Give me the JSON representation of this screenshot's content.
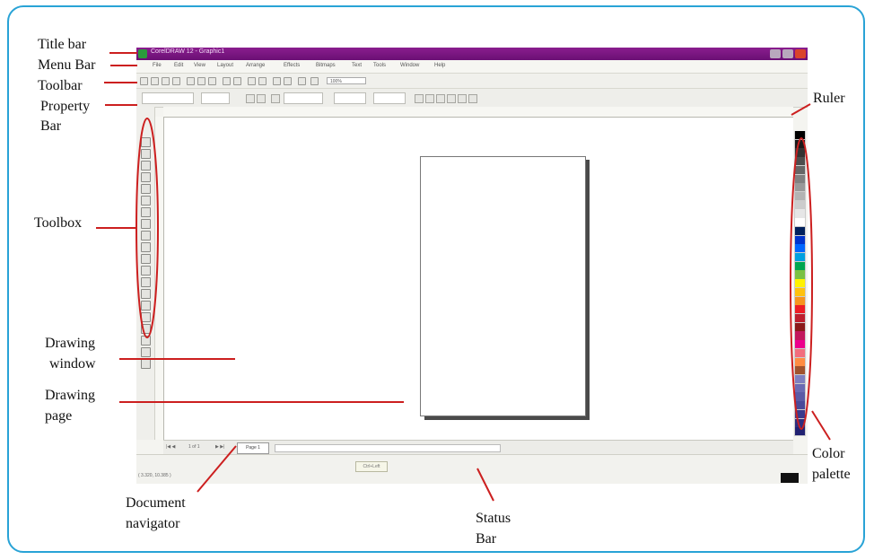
{
  "screenshot": {
    "window_title": "CorelDRAW 12 - Graphic1",
    "menu_items": [
      "File",
      "Edit",
      "View",
      "Layout",
      "Arrange",
      "Effects",
      "Bitmaps",
      "Text",
      "Tools",
      "Window",
      "Help"
    ],
    "zoom_value": "100%",
    "document_navigator": {
      "page_count_text": "1 of 1",
      "page_tab_label": "Page 1"
    },
    "status_hint": "Ctrl+Left",
    "status_coordinates": "( 3.320, 10.385 )"
  },
  "callouts": {
    "title_bar": "Title bar",
    "menu_bar": "Menu Bar",
    "toolbar": "Toolbar",
    "property_bar_line1": "Property",
    "property_bar_line2": "Bar",
    "toolbox": "Toolbox",
    "drawing_window_line1": "Drawing",
    "drawing_window_line2": "window",
    "drawing_page_line1": "Drawing",
    "drawing_page_line2": "page",
    "document_navigator_line1": "Document",
    "document_navigator_line2": "navigator",
    "ruler": "Ruler",
    "color_palette_line1": "Color",
    "color_palette_line2": "palette",
    "status_bar_line1": "Status",
    "status_bar_line2": "Bar"
  },
  "colors": {
    "frame": "#29a3d6",
    "callout_line": "#cc1f1f",
    "title_bar": "#7a1682",
    "palette_swatches": [
      "#000000",
      "#1a1a1a",
      "#333333",
      "#4d4d4d",
      "#666666",
      "#808080",
      "#999999",
      "#b3b3b3",
      "#cccccc",
      "#e6e6e6",
      "#ffffff",
      "#00205c",
      "#0033cc",
      "#0066ff",
      "#00a0e0",
      "#00a650",
      "#7ac143",
      "#fff200",
      "#ffc20e",
      "#f7941d",
      "#ed1c24",
      "#be1e2d",
      "#8b1a1a",
      "#c2185b",
      "#ec008c",
      "#f26d7d",
      "#ff8c42",
      "#a0522d",
      "#7f7fbf",
      "#6b6bb3",
      "#5a5aa6",
      "#4a4a99",
      "#3a3a8c",
      "#2e2e7f",
      "#222272"
    ]
  }
}
